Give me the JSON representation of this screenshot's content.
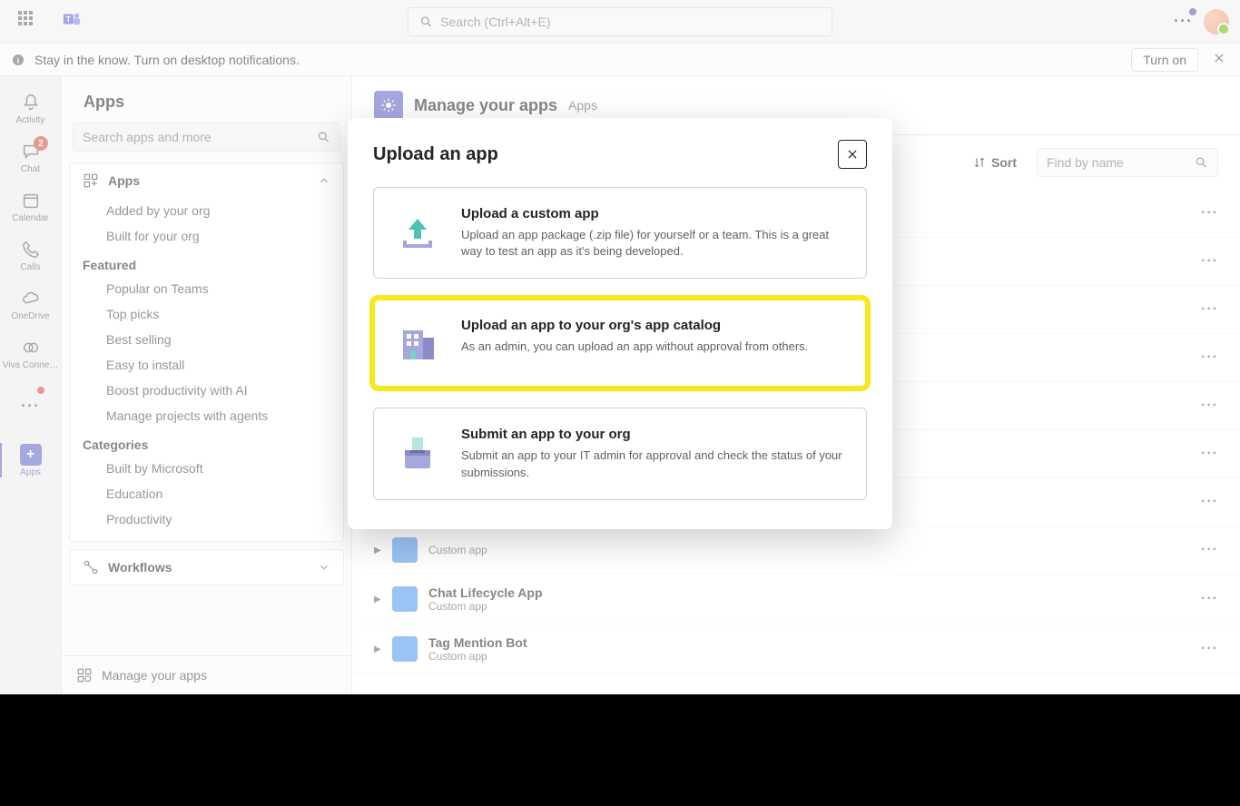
{
  "topbar": {
    "search_placeholder": "Search (Ctrl+Alt+E)"
  },
  "notif": {
    "text": "Stay in the know. Turn on desktop notifications.",
    "button": "Turn on"
  },
  "rail": {
    "activity": "Activity",
    "chat": "Chat",
    "chat_badge": "2",
    "calendar": "Calendar",
    "calls": "Calls",
    "onedrive": "OneDrive",
    "viva": "Viva Conne…",
    "apps": "Apps"
  },
  "sidebar": {
    "title": "Apps",
    "search_placeholder": "Search apps and more",
    "apps_label": "Apps",
    "items_added": [
      "Added by your org",
      "Built for your org"
    ],
    "featured_label": "Featured",
    "featured": [
      "Popular on Teams",
      "Top picks",
      "Best selling",
      "Easy to install",
      "Boost productivity with AI",
      "Manage projects with agents"
    ],
    "categories_label": "Categories",
    "categories": [
      "Built by Microsoft",
      "Education",
      "Productivity"
    ],
    "workflows": "Workflows",
    "manage": "Manage your apps"
  },
  "main": {
    "title": "Manage your apps",
    "subtitle": "Apps",
    "sort": "Sort",
    "find_placeholder": "Find by name",
    "rows": [
      {
        "title": "",
        "sub": ""
      },
      {
        "title": "",
        "sub": ""
      },
      {
        "title": "",
        "sub": ""
      },
      {
        "title": "",
        "sub": ""
      },
      {
        "title": "",
        "sub": ""
      },
      {
        "title": "",
        "sub": ""
      },
      {
        "title": "",
        "sub": ""
      },
      {
        "title": "",
        "sub": "Custom app"
      },
      {
        "title": "Chat Lifecycle App",
        "sub": "Custom app"
      },
      {
        "title": "Tag Mention Bot",
        "sub": "Custom app"
      }
    ]
  },
  "dialog": {
    "title": "Upload an app",
    "cards": [
      {
        "title": "Upload a custom app",
        "desc": "Upload an app package (.zip file) for yourself or a team. This is a great way to test an app as it's being developed."
      },
      {
        "title": "Upload an app to your org's app catalog",
        "desc": "As an admin, you can upload an app without approval from others."
      },
      {
        "title": "Submit an app to your org",
        "desc": "Submit an app to your IT admin for approval and check the status of your submissions."
      }
    ]
  }
}
